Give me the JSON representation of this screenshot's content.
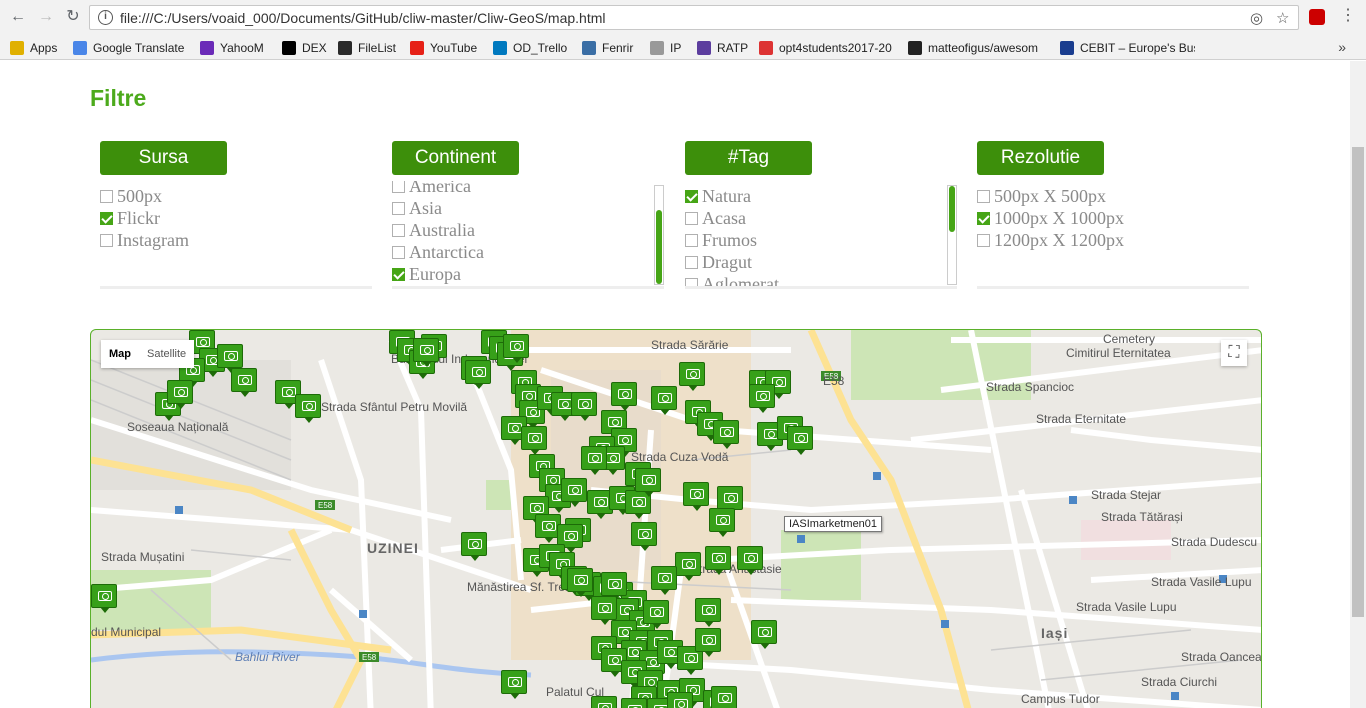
{
  "browser": {
    "url": "file:///C:/Users/voaid_000/Documents/GitHub/cliw-master/Cliw-GeoS/map.html",
    "bookmarks": [
      "Apps",
      "Google Translate",
      "YahooM",
      "DEX",
      "FileList",
      "YouTube",
      "OD_Trello",
      "Fenrir",
      "IP",
      "RATP",
      "opt4students2017-20",
      "matteofigus/awesom",
      "CEBIT – Europe's Busi"
    ],
    "bookmark_colors": [
      "#e0b000",
      "#4a86e8",
      "#6b2bb8",
      "#000",
      "#2a2a2a",
      "#e62117",
      "#0079bf",
      "#3a6ea5",
      "#999",
      "#5c3d9e",
      "#d33",
      "#222",
      "#1a3d8f"
    ]
  },
  "page": {
    "title": "Filtre",
    "filters": [
      {
        "label": "Sursa",
        "options": [
          {
            "text": "500px",
            "checked": false
          },
          {
            "text": "Flickr",
            "checked": true
          },
          {
            "text": "Instagram",
            "checked": false
          }
        ]
      },
      {
        "label": "Continent",
        "options": [
          {
            "text": "America",
            "checked": false
          },
          {
            "text": "Asia",
            "checked": false
          },
          {
            "text": "Australia",
            "checked": false
          },
          {
            "text": "Antarctica",
            "checked": false
          },
          {
            "text": "Europa",
            "checked": true
          }
        ]
      },
      {
        "label": "#Tag",
        "options": [
          {
            "text": "Natura",
            "checked": true
          },
          {
            "text": "Acasa",
            "checked": false
          },
          {
            "text": "Frumos",
            "checked": false
          },
          {
            "text": "Dragut",
            "checked": false
          },
          {
            "text": "Aglomerat",
            "checked": false
          }
        ]
      },
      {
        "label": "Rezolutie",
        "options": [
          {
            "text": "500px X 500px",
            "checked": false
          },
          {
            "text": "1000px X 1000px",
            "checked": true
          },
          {
            "text": "1200px X 1200px",
            "checked": false
          }
        ]
      }
    ]
  },
  "map": {
    "type_controls": [
      "Map",
      "Satellite"
    ],
    "active_type": "Map",
    "tooltip": "IASImarketmen01",
    "labels": [
      "Cemetery",
      "Cimitirul Eternitatea",
      "Strada Spancioc",
      "Strada Eternitate",
      "Strada Stejar",
      "Strada Tătărași",
      "Strada Dudescu",
      "Strada Vasile Lupu",
      "Strada Vasile Lupu",
      "Strada Oancea",
      "Strada Ciurchi",
      "Campus Tudor",
      "Iași",
      "UZINEI",
      "Mănăstirea Sf. Trei Ierarhi",
      "Palatul Cul",
      "Bahlui River",
      "dul Municipal",
      "Strada Sfântul Petru Movilă",
      "Soseaua Națională",
      "Strada Mușatini",
      "Bulevardul Independenței",
      "Strada Sărărie",
      "Strada Cuza Vodă",
      "Strada Anastasie",
      "E58"
    ]
  }
}
